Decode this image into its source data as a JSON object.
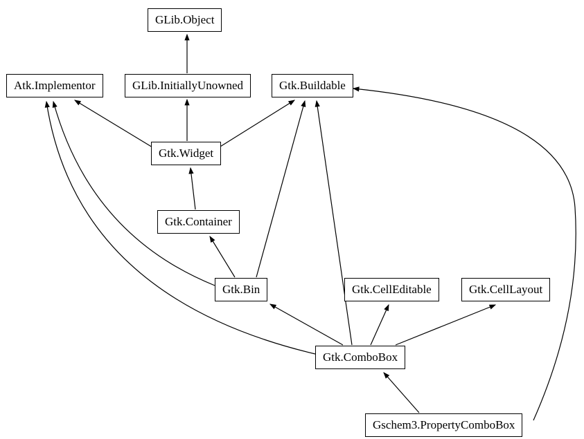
{
  "nodes": {
    "glib_object": "GLib.Object",
    "glib_initiallyunowned": "GLib.InitiallyUnowned",
    "atk_implementor": "Atk.Implementor",
    "gtk_buildable": "Gtk.Buildable",
    "gtk_widget": "Gtk.Widget",
    "gtk_container": "Gtk.Container",
    "gtk_bin": "Gtk.Bin",
    "gtk_celleditable": "Gtk.CellEditable",
    "gtk_celllayout": "Gtk.CellLayout",
    "gtk_combobox": "Gtk.ComboBox",
    "gschem3_propertycombobox": "Gschem3.PropertyComboBox"
  }
}
